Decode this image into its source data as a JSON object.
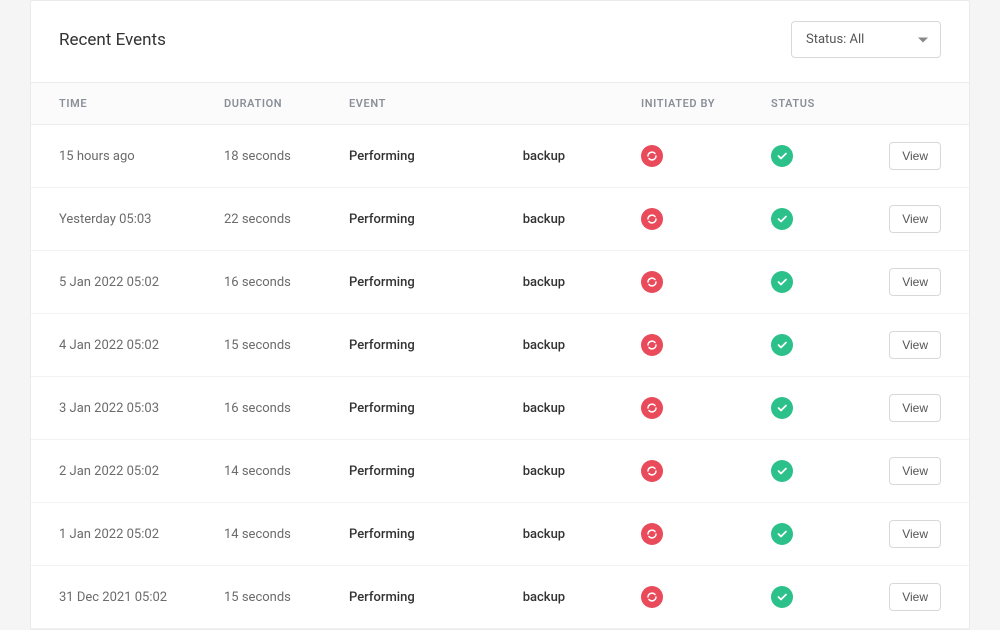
{
  "header": {
    "title": "Recent Events",
    "status_filter_label": "Status: All"
  },
  "columns": {
    "time": "TIME",
    "duration": "DURATION",
    "event": "EVENT",
    "initiated_by": "INITIATED BY",
    "status": "STATUS"
  },
  "view_label": "View",
  "event_word_1": "Performing",
  "event_word_2": "backup",
  "rows": [
    {
      "time": "15 hours ago",
      "duration": "18 seconds"
    },
    {
      "time": "Yesterday 05:03",
      "duration": "22 seconds"
    },
    {
      "time": "5 Jan 2022 05:02",
      "duration": "16 seconds"
    },
    {
      "time": "4 Jan 2022 05:02",
      "duration": "15 seconds"
    },
    {
      "time": "3 Jan 2022 05:03",
      "duration": "16 seconds"
    },
    {
      "time": "2 Jan 2022 05:02",
      "duration": "14 seconds"
    },
    {
      "time": "1 Jan 2022 05:02",
      "duration": "14 seconds"
    },
    {
      "time": "31 Dec 2021 05:02",
      "duration": "15 seconds"
    }
  ],
  "colors": {
    "initiated_icon": "#e94b5b",
    "status_icon": "#2cc18b"
  }
}
